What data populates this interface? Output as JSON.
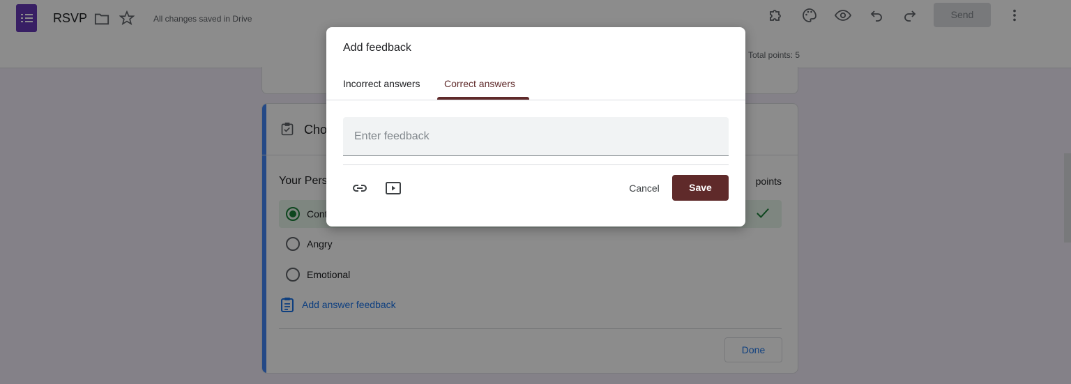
{
  "header": {
    "doc_title": "RSVP",
    "saved_status": "All changes saved in Drive",
    "send_label": "Send",
    "icons": [
      "folder-icon",
      "star-icon",
      "puzzle-icon",
      "palette-icon",
      "eye-icon",
      "undo-icon",
      "redo-icon",
      "more-vert-icon"
    ]
  },
  "sub_header": {
    "total_points": "Total points: 5"
  },
  "question_card": {
    "title_partial": "Cho",
    "question_partial": "Your Pers",
    "points_label": "points",
    "options": [
      {
        "label": "Cont",
        "selected": true,
        "correct": true
      },
      {
        "label": "Angry",
        "selected": false
      },
      {
        "label": "Emotional",
        "selected": false
      }
    ],
    "add_feedback_label": "Add answer feedback",
    "done_label": "Done"
  },
  "dialog": {
    "title": "Add feedback",
    "tabs": [
      {
        "label": "Incorrect answers",
        "active": false
      },
      {
        "label": "Correct answers",
        "active": true
      }
    ],
    "input_placeholder": "Enter feedback",
    "input_value": "",
    "cancel_label": "Cancel",
    "save_label": "Save"
  },
  "colors": {
    "accent": "#5f2a2a",
    "form_purple": "#673ab7",
    "correct_green": "#188038",
    "link_blue": "#1a73e8"
  }
}
